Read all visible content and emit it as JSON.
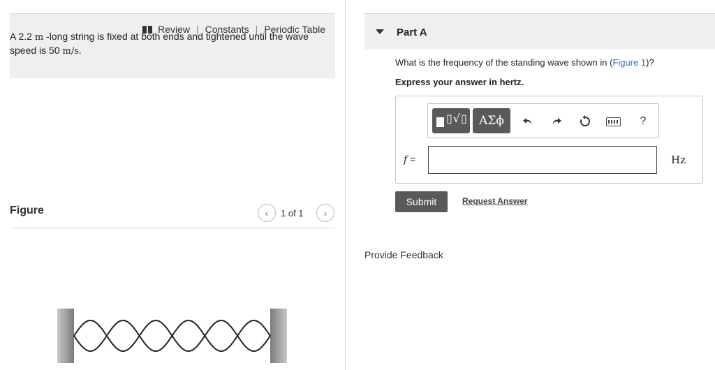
{
  "left": {
    "links": {
      "review": "Review",
      "constants": "Constants",
      "periodic_table": "Periodic Table",
      "separator": "|"
    },
    "problem": {
      "text_a": "A 2.2 ",
      "unit_m": "m",
      "text_b": " -long string is fixed at both ends and tightened until the wave speed is 50 ",
      "unit_speed": "m/s",
      "text_c": "."
    },
    "figure": {
      "label": "Figure",
      "count": "1 of 1",
      "prev": "‹",
      "next": "›",
      "antinodes": 6
    }
  },
  "right": {
    "part_title": "Part A",
    "question_before": "What is the frequency of the standing wave shown in (",
    "question_link": "Figure 1",
    "question_after": ")?",
    "instruction": "Express your answer in hertz.",
    "toolbar": {
      "greek": "ΑΣϕ",
      "template_symbol": "▯√▯",
      "undo_icon": "undo-icon",
      "redo_icon": "redo-icon",
      "reset_icon": "reset-icon",
      "keyboard_icon": "keyboard-icon",
      "help": "?"
    },
    "answer": {
      "variable": "f",
      "equals": " =",
      "value": "",
      "unit": "Hz"
    },
    "submit_label": "Submit",
    "request_answer_label": "Request Answer",
    "feedback_label": "Provide Feedback"
  }
}
